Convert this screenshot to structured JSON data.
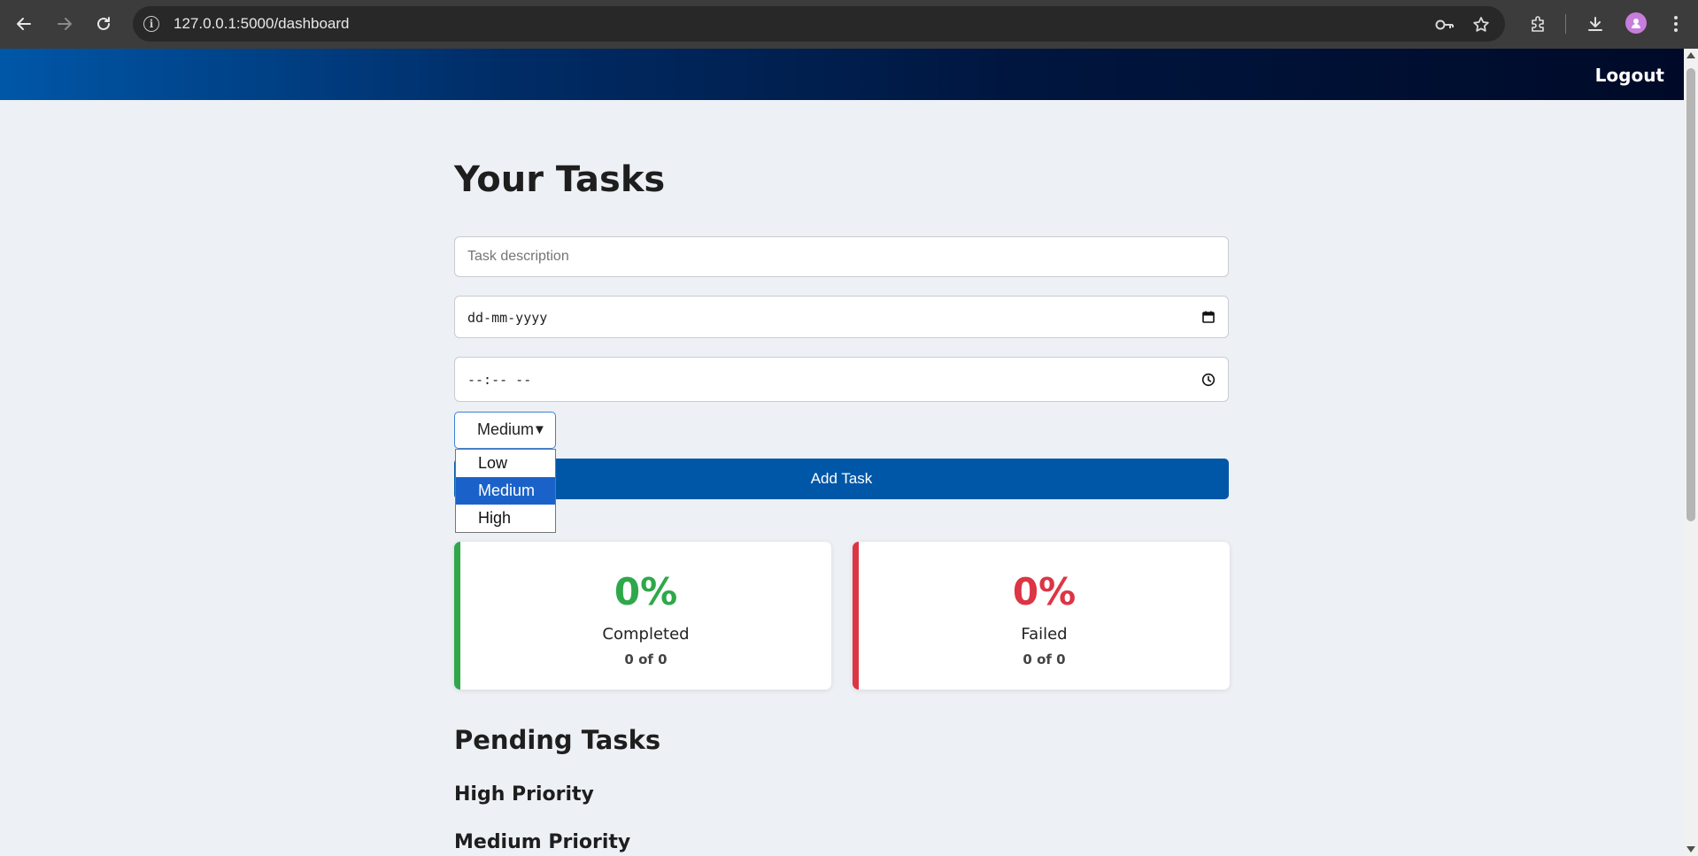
{
  "browser": {
    "url": "127.0.0.1:5000/dashboard",
    "icons": [
      "back-arrow-icon",
      "forward-arrow-icon",
      "reload-icon",
      "site-info-icon",
      "password-key-icon",
      "bookmark-star-icon",
      "extensions-icon",
      "download-icon",
      "profile-avatar-icon",
      "more-menu-icon"
    ]
  },
  "header": {
    "logout_label": "Logout"
  },
  "main": {
    "title": "Your Tasks",
    "task_input": {
      "placeholder": "Task description",
      "value": ""
    },
    "date_input": {
      "placeholder": "dd-mm-yyyy"
    },
    "time_input": {
      "placeholder": "--:-- --"
    },
    "priority_select": {
      "selected": "Medium",
      "arrow": "▼",
      "options": [
        "Low",
        "Medium",
        "High"
      ]
    },
    "add_button_label": "Add Task",
    "stats": {
      "completed": {
        "value": "0%",
        "label": "Completed",
        "count": "0 of 0",
        "color": "#2ea84a"
      },
      "failed": {
        "value": "0%",
        "label": "Failed",
        "count": "0 of 0",
        "color": "#dc3545"
      }
    },
    "pending_heading": "Pending Tasks",
    "priority_headings": [
      "High Priority",
      "Medium Priority"
    ]
  },
  "colors": {
    "accent": "#0057a8",
    "header_gradient_start": "#0057a8",
    "header_gradient_end": "#000a28",
    "page_background": "#edf0f5",
    "dropdown_selected": "#1a62c9"
  }
}
